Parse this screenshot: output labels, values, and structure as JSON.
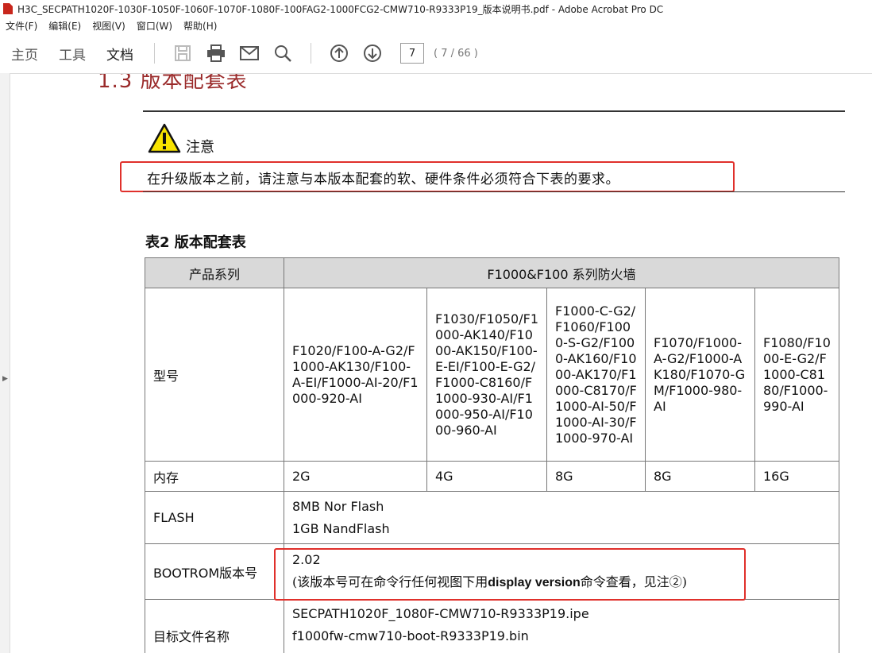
{
  "window": {
    "title": "H3C_SECPATH1020F-1030F-1050F-1060F-1070F-1080F-100FAG2-1000FCG2-CMW710-R9333P19_版本说明书.pdf - Adobe Acrobat Pro DC"
  },
  "menu": [
    "文件(F)",
    "编辑(E)",
    "视图(V)",
    "窗口(W)",
    "帮助(H)"
  ],
  "toolbar": {
    "tabs": [
      "主页",
      "工具",
      "文档"
    ],
    "page_current": "7",
    "page_count": "( 7 / 66 )"
  },
  "doc": {
    "heading": "1.3  版本配套表",
    "warning_label": "注意",
    "notice": "在升级版本之前，请注意与本版本配套的软、硬件条件必须符合下表的要求。",
    "table_title": "表2 版本配套表",
    "table": {
      "hdr_label": "产品系列",
      "hdr_value": "F1000&F100 系列防火墙",
      "model_label": "型号",
      "models": [
        "F1020/F100-A-G2/F1000-AK130/F100-A-EI/F1000-AI-20/F1000-920-AI",
        "F1030/F1050/F1000-AK140/F1000-AK150/F100-E-EI/F100-E-G2/F1000-C8160/F1000-930-AI/F1000-950-AI/F1000-960-AI",
        "F1000-C-G2/F1060/F1000-S-G2/F1000-AK160/F1000-AK170/F1000-C8170/F1000-AI-50/F1000-AI-30/F1000-970-AI",
        "F1070/F1000-A-G2/F1000-AK180/F1070-GM/F1000-980-AI",
        "F1080/F1000-E-G2/F1000-C8180/F1000-990-AI"
      ],
      "memory_label": "内存",
      "memory": [
        "2G",
        "4G",
        "8G",
        "8G",
        "16G"
      ],
      "flash_label": "FLASH",
      "flash_line1": "8MB Nor Flash",
      "flash_line2": "1GB NandFlash",
      "bootrom_label": "BOOTROM版本号",
      "bootrom_version": "2.02",
      "bootrom_note_a": "(该版本号可在命令行任何视图下用",
      "bootrom_note_cmd": "display version",
      "bootrom_note_b": "命令查看，见注②)",
      "target_label": "目标文件名称",
      "target_line1": "SECPATH1020F_1080F-CMW710-R9333P19.ipe",
      "target_line2": "f1000fw-cmw710-boot-R9333P19.bin"
    }
  },
  "colors": {
    "heading": "#9a2a2a",
    "highlight_box": "#e0302b",
    "table_header_bg": "#d9d9d9",
    "warning_yellow": "#f7e300"
  }
}
